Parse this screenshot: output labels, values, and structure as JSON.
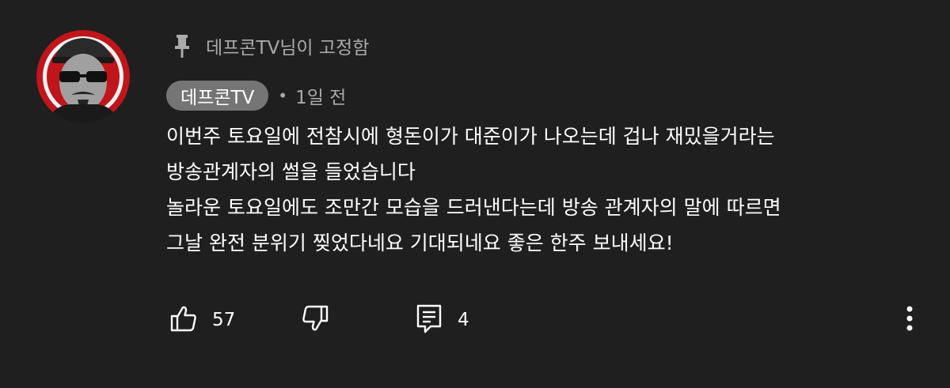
{
  "pinned": {
    "icon": "pin-icon",
    "text": "데프콘TV님이 고정함"
  },
  "author": {
    "name": "데프콘TV",
    "avatar_icon": "avatar-icon"
  },
  "timestamp": "1일 전",
  "separator": "•",
  "body_lines": [
    "이번주 토요일에 전참시에 형돈이가 대준이가 나오는데 겁나 재밌을거라는",
    "방송관계자의 썰을 들었습니다",
    "놀라운 토요일에도 조만간 모습을 드러낸다는데 방송 관계자의 말에 따르면",
    "그날 완전 분위기 찢었다네요 기대되네요 좋은 한주 보내세요!"
  ],
  "actions": {
    "like": {
      "icon": "thumbs-up-icon",
      "count": "57"
    },
    "dislike": {
      "icon": "thumbs-down-icon"
    },
    "reply": {
      "icon": "comment-icon",
      "count": "4"
    },
    "more": {
      "icon": "more-vertical-icon"
    }
  },
  "colors": {
    "background": "#1f1f1f",
    "secondary_text": "#aaaaaa",
    "chip_background": "#757575",
    "avatar_ring": "#c0151a"
  }
}
